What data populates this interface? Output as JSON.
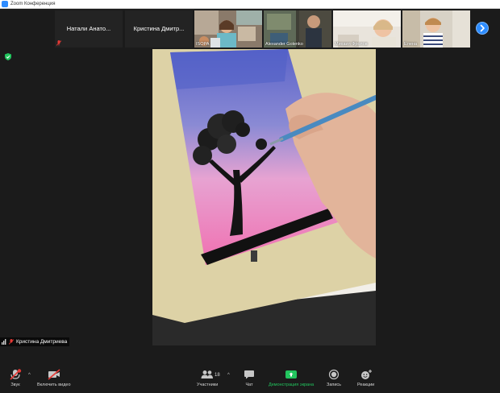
{
  "window": {
    "title": "Zoom Конференция"
  },
  "participants_strip": {
    "name_tiles": [
      {
        "name": "Натали Анато..."
      },
      {
        "name": "Кристина Дмитр..."
      }
    ],
    "video_tiles": [
      {
        "label": "ISOPA"
      },
      {
        "label": "Alexander Golenko"
      },
      {
        "label": "Михаил Фролов"
      },
      {
        "label": "Елена"
      }
    ]
  },
  "active_speaker": {
    "name": "Кристина Дмитриева"
  },
  "toolbar": {
    "audio_label": "Звук",
    "video_label": "Включить видео",
    "participants_label": "Участники",
    "participants_count": "18",
    "chat_label": "Чат",
    "share_label": "Демонстрация экрана",
    "record_label": "Запись",
    "reactions_label": "Реакции"
  },
  "colors": {
    "background": "#1b1b1b",
    "accent": "#2d8cff",
    "share_green": "#22c55e",
    "mic_muted_red": "#e53935"
  }
}
